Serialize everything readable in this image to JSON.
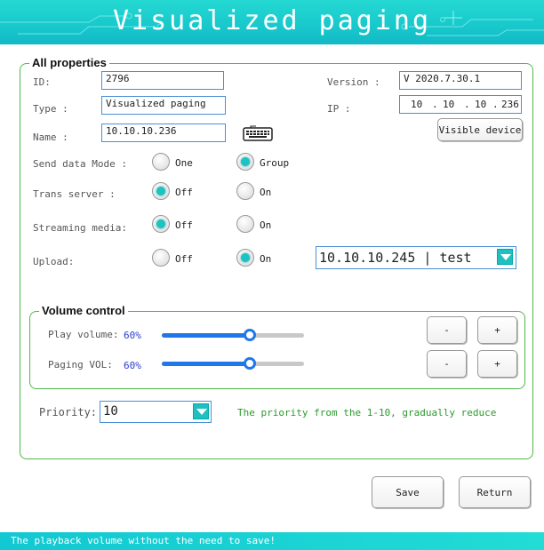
{
  "window": {
    "title": "Visualized paging"
  },
  "all_properties": {
    "label": "All properties",
    "id": {
      "label": "ID:",
      "value": "2796"
    },
    "type": {
      "label": "Type :",
      "value": "Visualized paging"
    },
    "name": {
      "label": "Name :",
      "value": "10.10.10.236"
    },
    "version": {
      "label": "Version  :",
      "value": "V 2020.7.30.1"
    },
    "ip": {
      "label": "IP    :",
      "octets": [
        "10",
        "10",
        "10",
        "236"
      ],
      "dot": "."
    },
    "keyboard_icon": "keyboard-icon",
    "visible_device_button": "Visible device",
    "send_data_mode": {
      "label": "Send data Mode :",
      "options": [
        "One",
        "Group"
      ],
      "selected": "Group"
    },
    "trans_server": {
      "label": "Trans server  :",
      "options": [
        "Off",
        "On"
      ],
      "selected": "Off"
    },
    "streaming_media": {
      "label": "Streaming media:",
      "options": [
        "Off",
        "On"
      ],
      "selected": "Off"
    },
    "upload": {
      "label": "Upload:",
      "options": [
        "Off",
        "On"
      ],
      "selected": "On"
    },
    "upload_server": {
      "value": "10.10.10.245 | test"
    }
  },
  "volume_control": {
    "label": "Volume control",
    "play_volume": {
      "label": "Play volume:",
      "percent_text": "60%",
      "level": 0.6
    },
    "paging_vol": {
      "label": "Paging VOL:",
      "percent_text": "60%",
      "level": 0.6
    },
    "minus_label": "-",
    "plus_label": "+"
  },
  "priority": {
    "label": "Priority:",
    "value": "10",
    "hint": "The priority from the 1-10, gradually reduce"
  },
  "buttons": {
    "save": "Save",
    "return": "Return"
  },
  "status": {
    "message": "The playback volume without the need to save!"
  },
  "colors": {
    "accent": "#1ec2c2",
    "slider": "#1f77ea",
    "group_border": "#4fb84a"
  }
}
